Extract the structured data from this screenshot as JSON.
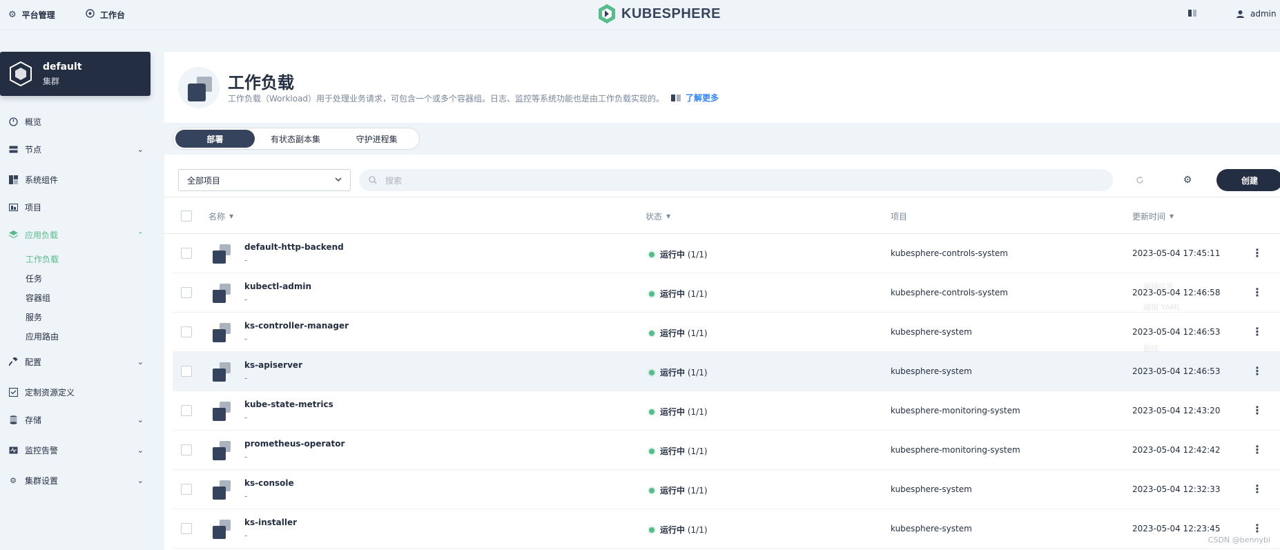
{
  "topbar": {
    "platform": "平台管理",
    "workbench": "工作台",
    "logo": "KUBESPHERE",
    "user": "admin"
  },
  "cluster": {
    "name": "default",
    "type": "集群"
  },
  "sidebar": {
    "items": [
      {
        "label": "概览",
        "icon": "dashboard-icon"
      },
      {
        "label": "节点",
        "icon": "node-icon",
        "expandable": true
      },
      {
        "label": "系统组件",
        "icon": "components-icon"
      },
      {
        "label": "项目",
        "icon": "project-icon"
      },
      {
        "label": "应用负载",
        "icon": "layers-icon",
        "expandable": true,
        "active": true
      },
      {
        "label": "配置",
        "icon": "hammer-icon",
        "expandable": true
      },
      {
        "label": "定制资源定义",
        "icon": "crd-icon"
      },
      {
        "label": "存储",
        "icon": "storage-icon",
        "expandable": true
      },
      {
        "label": "监控告警",
        "icon": "monitor-icon",
        "expandable": true
      },
      {
        "label": "集群设置",
        "icon": "gear-icon",
        "expandable": true
      }
    ],
    "workload_sub": [
      "工作负载",
      "任务",
      "容器组",
      "服务",
      "应用路由"
    ]
  },
  "header": {
    "title": "工作负载",
    "description": "工作负载（Workload）用于处理业务请求，可包含一个或多个容器组。日志、监控等系统功能也是由工作负载实现的。",
    "learn_more": "了解更多"
  },
  "tabs": [
    "部署",
    "有状态副本集",
    "守护进程集"
  ],
  "toolbar": {
    "project_select": "全部项目",
    "search_placeholder": "搜索",
    "create": "创建"
  },
  "table": {
    "headers": {
      "name": "名称",
      "status": "状态",
      "project": "项目",
      "updated": "更新时间"
    },
    "rows": [
      {
        "name": "default-http-backend",
        "sub": "-",
        "status": "运行中",
        "count": "(1/1)",
        "project": "kubesphere-controls-system",
        "time": "2023-05-04 17:45:11"
      },
      {
        "name": "kubectl-admin",
        "sub": "-",
        "status": "运行中",
        "count": "(1/1)",
        "project": "kubesphere-controls-system",
        "time": "2023-05-04 12:46:58"
      },
      {
        "name": "ks-controller-manager",
        "sub": "-",
        "status": "运行中",
        "count": "(1/1)",
        "project": "kubesphere-system",
        "time": "2023-05-04 12:46:53"
      },
      {
        "name": "ks-apiserver",
        "sub": "-",
        "status": "运行中",
        "count": "(1/1)",
        "project": "kubesphere-system",
        "time": "2023-05-04 12:46:53"
      },
      {
        "name": "kube-state-metrics",
        "sub": "-",
        "status": "运行中",
        "count": "(1/1)",
        "project": "kubesphere-monitoring-system",
        "time": "2023-05-04 12:43:20"
      },
      {
        "name": "prometheus-operator",
        "sub": "-",
        "status": "运行中",
        "count": "(1/1)",
        "project": "kubesphere-monitoring-system",
        "time": "2023-05-04 12:42:42"
      },
      {
        "name": "ks-console",
        "sub": "-",
        "status": "运行中",
        "count": "(1/1)",
        "project": "kubesphere-system",
        "time": "2023-05-04 12:32:33"
      },
      {
        "name": "ks-installer",
        "sub": "-",
        "status": "运行中",
        "count": "(1/1)",
        "project": "kubesphere-system",
        "time": "2023-05-04 12:23:45"
      }
    ]
  },
  "ghost_menu": [
    "编辑信息",
    "编辑 YAML",
    "删除"
  ],
  "watermark": "CSDN @bennybi",
  "colors": {
    "accent": "#55bc8a",
    "dark": "#242e42",
    "bg": "#eff4f9"
  }
}
